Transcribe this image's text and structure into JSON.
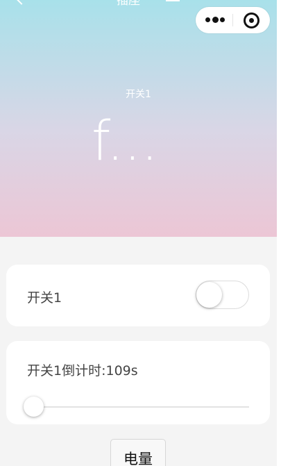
{
  "nav": {
    "title": "插座",
    "back_icon": "chevron-left-icon",
    "menu_icon": "hamburger-menu-icon"
  },
  "capsule": {
    "more_icon": "more-dots-icon",
    "close_icon": "target-close-icon"
  },
  "hero": {
    "label": "开关1",
    "value": "f...",
    "gradient_top": "#a8e1ea",
    "gradient_bottom": "#ecc6d5"
  },
  "switch_card": {
    "label": "开关1",
    "toggle_on": false
  },
  "timer_card": {
    "label": "开关1倒计时:109s",
    "slider_fraction": 0.0
  },
  "battery_button": {
    "label": "电量"
  }
}
